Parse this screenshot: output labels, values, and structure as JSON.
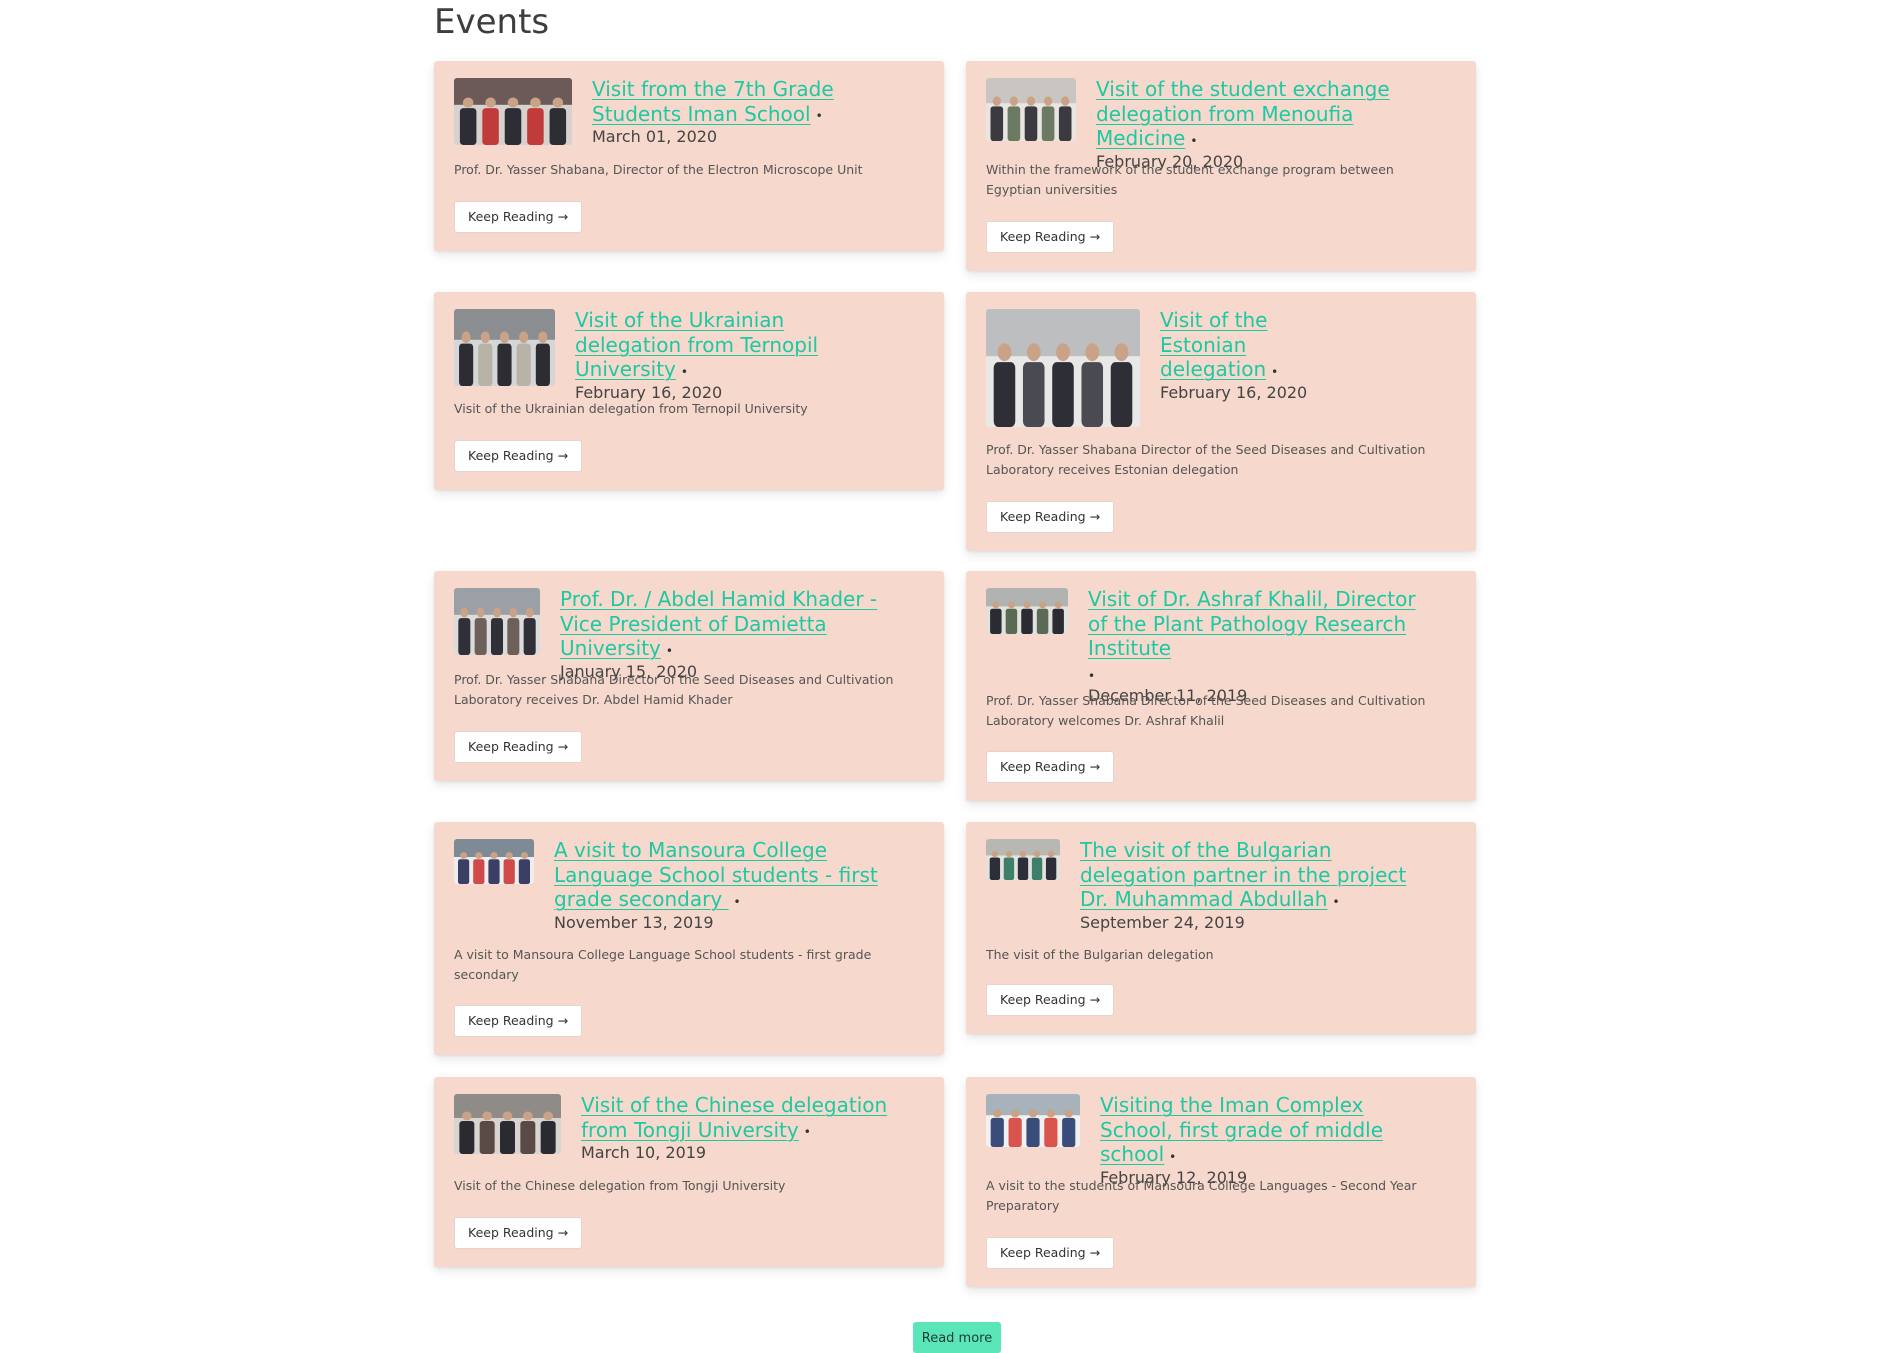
{
  "heading": "Events",
  "cards": [
    {
      "title": "Visit from the 7th Grade Students Iman School",
      "date": "March 01, 2020",
      "excerpt": "Prof. Dr. Yasser Shabana, Director of the Electron Microscope Unit",
      "thumb_icon": "group-photo-icon"
    },
    {
      "title": "Visit of the student exchange delegation from Menoufia Medicine",
      "date": "February 20, 2020",
      "excerpt": "Within the framework of the student exchange program between Egyptian universities",
      "thumb_icon": "group-photo-icon"
    },
    {
      "title": "Visit of the Ukrainian delegation from Ternopil University",
      "date": "February 16, 2020",
      "excerpt": "Visit of the Ukrainian delegation from Ternopil University",
      "thumb_icon": "group-photo-icon"
    },
    {
      "title": "Visit of the Estonian delegation",
      "date": "February 16, 2020",
      "excerpt": "Prof. Dr. Yasser Shabana Director of the Seed Diseases and Cultivation Laboratory receives Estonian delegation",
      "thumb_icon": "group-photo-icon"
    },
    {
      "title": "Prof. Dr. / Abdel Hamid Khader - Vice President of Damietta University",
      "date": "January 15, 2020",
      "excerpt": "Prof. Dr. Yasser Shabana Director of the Seed Diseases and Cultivation Laboratory receives Dr. Abdel Hamid Khader",
      "thumb_icon": "group-photo-icon"
    },
    {
      "title": "Visit of Dr. Ashraf Khalil, Director of the Plant Pathology Research Institute",
      "date": "December 11, 2019",
      "excerpt": "Prof. Dr. Yasser Shabana Director of the Seed Diseases and Cultivation Laboratory welcomes Dr. Ashraf Khalil",
      "thumb_icon": "group-photo-icon"
    },
    {
      "title": "A visit to Mansoura College Language School students - first grade secondary ",
      "date": "November 13, 2019",
      "excerpt": "A visit to Mansoura College Language School students - first grade secondary",
      "thumb_icon": "group-photo-icon"
    },
    {
      "title": "The visit of the Bulgarian delegation partner in the project Dr. Muhammad Abdullah",
      "date": "September 24, 2019",
      "excerpt": "The visit of the Bulgarian delegation",
      "thumb_icon": "group-photo-icon"
    },
    {
      "title": "Visit of the Chinese delegation from Tongji University",
      "date": "March 10, 2019",
      "excerpt": "Visit of the Chinese delegation from Tongji University",
      "thumb_icon": "group-photo-icon"
    },
    {
      "title": "Visiting the Iman Complex School, first grade of middle school",
      "date": "February 12, 2019",
      "excerpt": "A visit to the students of Mansoura College Languages - Second Year Preparatory",
      "thumb_icon": "group-photo-icon"
    }
  ],
  "separator": "•",
  "keep_reading_label": "Keep Reading →",
  "read_more_label": "Read more",
  "colors": {
    "card_bg": "#f6d8cc",
    "link": "#1cc9a3",
    "read_more_bg": "#5be6b9"
  }
}
